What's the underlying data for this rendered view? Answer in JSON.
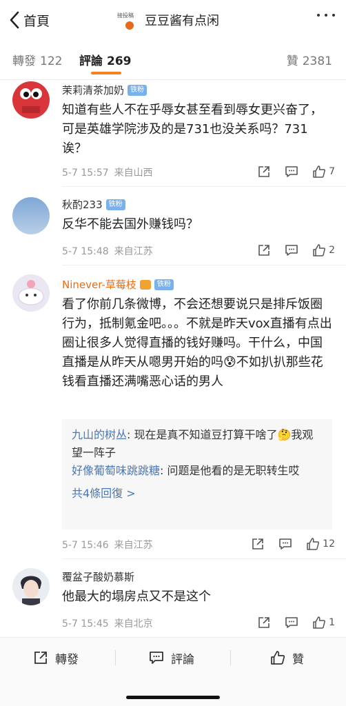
{
  "header": {
    "back_label": "首頁",
    "title_tag": "接投稿",
    "title": "豆豆酱有点闲"
  },
  "tabs": {
    "repost": {
      "label": "轉發",
      "count": "122"
    },
    "comments": {
      "label": "評論",
      "count": "269"
    },
    "likes": {
      "label": "贊",
      "count": "2381"
    }
  },
  "colors": {
    "accent": "#f5821f",
    "link": "#4a78b5",
    "fan_badge": "#7bb1ea"
  },
  "comments": [
    {
      "user": "茉莉清茶加奶",
      "badge": "铁粉",
      "text": "知道有些人不在乎辱女甚至看到辱女更兴奋了，可是英雄学院涉及的是731也没关系吗？731诶？",
      "time": "5-7 15:57",
      "source": "来自山西",
      "likes": "7"
    },
    {
      "user": "秋酌233",
      "badge": "铁粉",
      "text": "反华不能去国外赚钱吗？",
      "time": "5-7 15:48",
      "source": "来自江苏",
      "likes": "2"
    },
    {
      "user": "Ninever-草莓枝",
      "badge": "铁粉",
      "text": "看了你前几条微博，不会还想要说只是排斥饭圈行为，抵制氪金吧。。。不就是昨天vox直播有点出圈让很多人觉得直播的钱好赚吗。干什么，中国直播是从昨天从嗯男开始的吗😰不如扒扒那些花钱看直播还满嘴恶心话的男人",
      "time": "5-7 15:46",
      "source": "来自江苏",
      "likes": "12",
      "replies": [
        {
          "user": "九山的树丛",
          "text": "现在是真不知道豆打算干啥了🤔我观望一阵子"
        },
        {
          "user": "好像葡萄味跳跳糖",
          "text": "问题是他看的是无职转生哎"
        }
      ],
      "more_replies": "共4條回復 >"
    },
    {
      "user": "覆盆子酸奶慕斯",
      "text": "他最大的塌房点又不是这个",
      "time": "5-7 15:45",
      "source": "来自北京",
      "likes": "1"
    }
  ],
  "bottom_bar": {
    "repost": "轉發",
    "comment": "評論",
    "like": "贊"
  }
}
